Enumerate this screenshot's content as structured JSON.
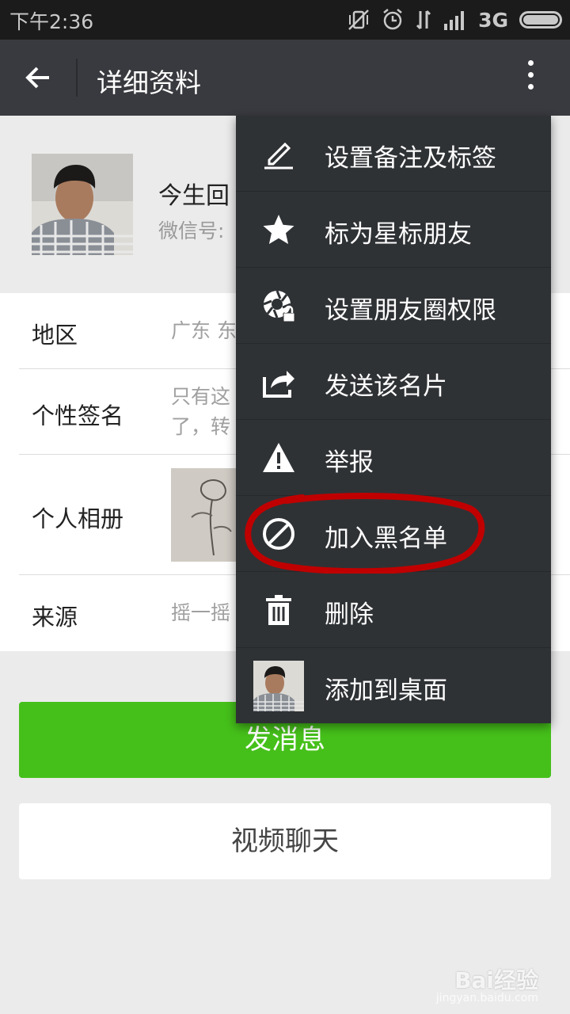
{
  "status_bar": {
    "time": "下午2:36",
    "network": "3G",
    "icons": [
      "vibrate-off-icon",
      "alarm-icon",
      "data-arrows-icon",
      "signal-icon",
      "battery-icon"
    ]
  },
  "app_bar": {
    "title": "详细资料",
    "back_icon": "arrow-left-icon",
    "more_icon": "more-vertical-icon"
  },
  "profile": {
    "name": "今生回",
    "wechat_id_label": "微信号:"
  },
  "info_rows": [
    {
      "label": "地区",
      "value": "广东  东"
    },
    {
      "label": "个性签名",
      "value_line1": "只有这",
      "value_line2": "了，转"
    },
    {
      "label": "个人相册"
    },
    {
      "label": "来源",
      "value": "摇一摇"
    }
  ],
  "buttons": {
    "send_message": "发消息",
    "video_chat": "视频聊天"
  },
  "menu": {
    "items": [
      {
        "label": "设置备注及标签",
        "icon": "edit-pencil-icon"
      },
      {
        "label": "标为星标朋友",
        "icon": "star-icon"
      },
      {
        "label": "设置朋友圈权限",
        "icon": "moments-lock-icon"
      },
      {
        "label": "发送该名片",
        "icon": "share-icon"
      },
      {
        "label": "举报",
        "icon": "warning-icon"
      },
      {
        "label": "加入黑名单",
        "icon": "block-icon"
      },
      {
        "label": "删除",
        "icon": "trash-icon"
      },
      {
        "label": "添加到桌面",
        "icon": "avatar-thumbnail"
      }
    ],
    "highlight_color": "#c00000"
  },
  "watermark": {
    "brand": "Bai经验",
    "url": "jingyan.baidu.com"
  },
  "colors": {
    "status_bar": "#1b1b1b",
    "app_bar": "#393a3f",
    "menu_bg": "#2f3235",
    "accent_green": "#45c01a",
    "page_bg": "#ebebeb"
  }
}
